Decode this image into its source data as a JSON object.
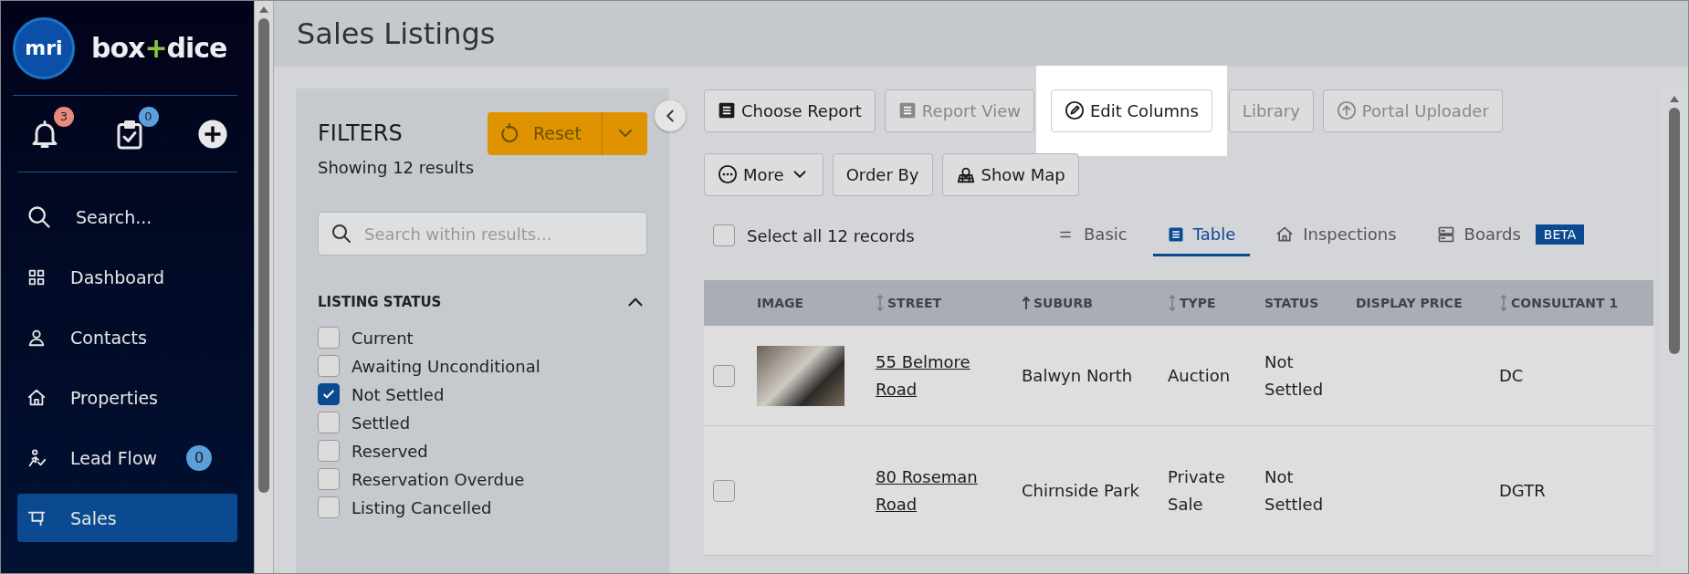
{
  "sidebar": {
    "logo_text": "mri",
    "brand": [
      "box",
      "+",
      "dice"
    ],
    "quick_actions": [
      {
        "kind": "bell",
        "badge": "3"
      },
      {
        "kind": "tasks",
        "badge": "0"
      },
      {
        "kind": "add"
      }
    ],
    "nav": [
      {
        "label": "Search...",
        "selected": false
      },
      {
        "label": "Dashboard",
        "selected": false
      },
      {
        "label": "Contacts",
        "selected": false
      },
      {
        "label": "Properties",
        "selected": false
      },
      {
        "label": "Lead Flow",
        "badge": "0",
        "selected": false
      },
      {
        "label": "Sales",
        "selected": true
      }
    ]
  },
  "page_title": "Sales Listings",
  "filters": {
    "title": "FILTERS",
    "reset_label": "Reset",
    "result_count": "Showing 12 results",
    "search_placeholder": "Search within results...",
    "section": {
      "title": "LISTING STATUS",
      "expanded": true,
      "options": [
        {
          "label": "Current",
          "checked": false
        },
        {
          "label": "Awaiting Unconditional",
          "checked": false
        },
        {
          "label": "Not Settled",
          "checked": true
        },
        {
          "label": "Settled",
          "checked": false
        },
        {
          "label": "Reserved",
          "checked": false
        },
        {
          "label": "Reservation Overdue",
          "checked": false
        },
        {
          "label": "Listing Cancelled",
          "checked": false
        }
      ]
    }
  },
  "toolbar": [
    [
      {
        "label": "Choose Report",
        "disabled": false,
        "highlighted": false
      },
      {
        "label": "Report View",
        "disabled": true,
        "highlighted": false
      },
      {
        "label": "Edit Columns",
        "disabled": false,
        "highlighted": true
      },
      {
        "label": "Library",
        "disabled": true,
        "highlighted": false
      },
      {
        "label": "Portal Uploader",
        "disabled": true,
        "highlighted": false
      }
    ],
    [
      {
        "label": "More",
        "caret": true,
        "disabled": false,
        "highlighted": false
      },
      {
        "label": "Order By",
        "disabled": false,
        "highlighted": false
      },
      {
        "label": "Show Map",
        "disabled": false,
        "highlighted": false
      }
    ]
  ],
  "select_all": {
    "label": "Select all 12 records",
    "checked": false
  },
  "views": [
    {
      "label": "Basic",
      "selected": false
    },
    {
      "label": "Table",
      "selected": true
    },
    {
      "label": "Inspections",
      "selected": false
    },
    {
      "label": "Boards",
      "badge": "BETA",
      "selected": false
    }
  ],
  "table": {
    "columns": [
      {
        "label": "IMAGE",
        "kind": "plain"
      },
      {
        "label": "STREET",
        "kind": "sortable"
      },
      {
        "label": "SUBURB",
        "kind": "ascending"
      },
      {
        "label": "TYPE",
        "kind": "sortable"
      },
      {
        "label": "STATUS",
        "kind": "plain"
      },
      {
        "label": "DISPLAY PRICE",
        "kind": "plain"
      },
      {
        "label": "CONSULTANT 1",
        "kind": "sortable"
      }
    ],
    "rows": [
      {
        "selected": false,
        "has_image": true,
        "street": "55 Belmore Road",
        "suburb": "Balwyn North",
        "type": "Auction",
        "status": "Not Settled",
        "consultant": "DC"
      },
      {
        "selected": false,
        "has_image": false,
        "street": "80 Roseman Road",
        "suburb": "Chirnside Park",
        "type": "Private Sale",
        "status": "Not Settled",
        "consultant": "DGTR"
      }
    ]
  }
}
